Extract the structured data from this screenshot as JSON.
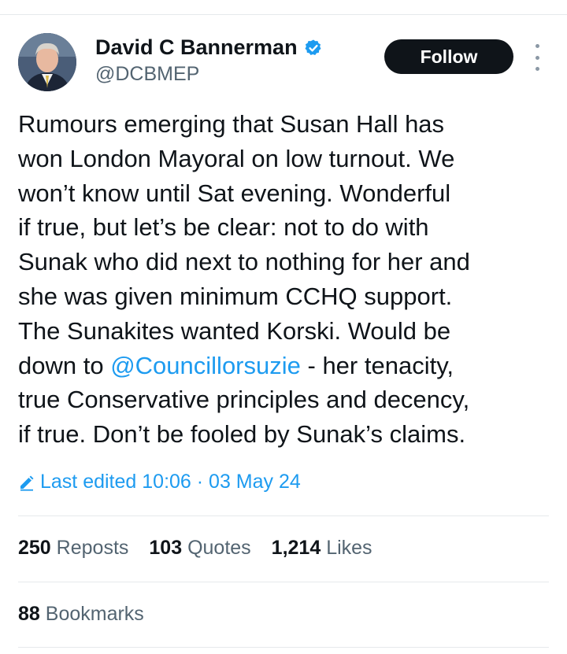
{
  "author": {
    "name": "David C Bannerman",
    "handle": "@DCBMEP",
    "verified_icon": "verified-badge-icon",
    "badge_color": "#1d9bf0"
  },
  "actions": {
    "follow_label": "Follow",
    "more_icon": "vertical-ellipsis-icon"
  },
  "tweet": {
    "lines": [
      "Rumours emerging that Susan Hall has",
      "won London Mayoral on low turnout. We",
      "won’t know until Sat evening. Wonderful",
      "if true, but let’s be clear: not to do with",
      "Sunak who did next to nothing for her and",
      "she was given minimum CCHQ support.",
      "The Sunakites wanted Korski. Would be"
    ],
    "line8_prefix": "down to ",
    "mention": "@Councillorsuzie",
    "line8_suffix": " - her tenacity,",
    "lines_end": [
      "true Conservative principles and decency,",
      "if true. Don’t be fooled by Sunak’s claims."
    ]
  },
  "edited": {
    "icon": "pencil-icon",
    "text": "Last edited 10:06 · 03 May 24"
  },
  "stats": {
    "reposts_count": "250",
    "reposts_label": "Reposts",
    "quotes_count": "103",
    "quotes_label": "Quotes",
    "likes_count": "1,214",
    "likes_label": "Likes",
    "bookmarks_count": "88",
    "bookmarks_label": "Bookmarks"
  },
  "colors": {
    "link": "#1d9bf0",
    "secondary_text": "#536471",
    "button_bg": "#0f1419"
  }
}
